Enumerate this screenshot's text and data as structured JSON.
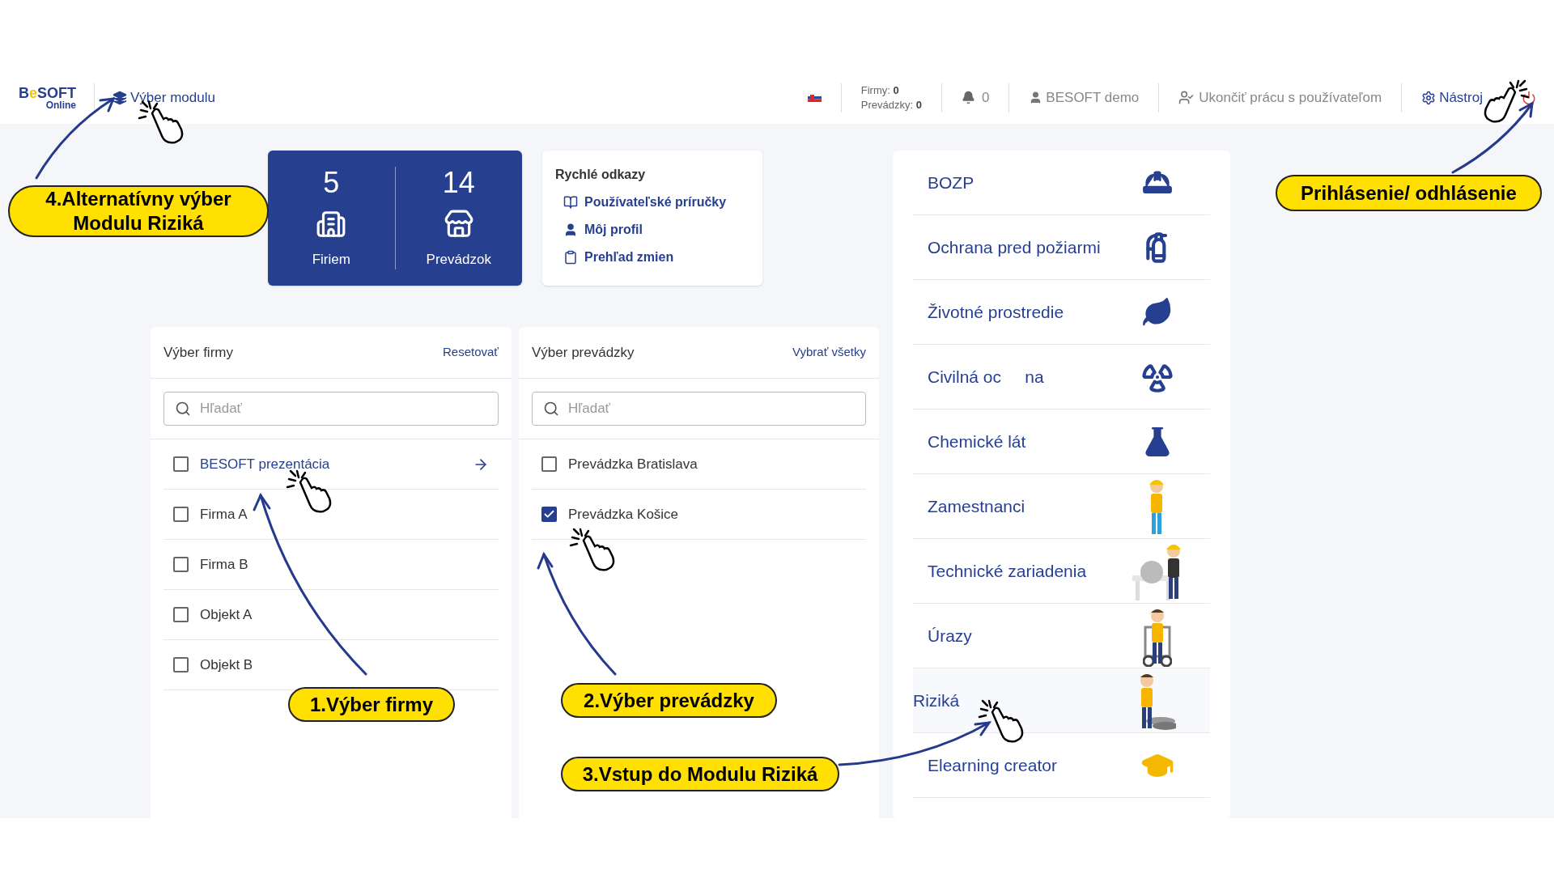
{
  "header": {
    "logo": {
      "parts": [
        "B",
        "e",
        "SOFT"
      ],
      "sub": "Online"
    },
    "module_link": "Výber modulu",
    "counts": [
      {
        "label": "Firmy:",
        "value": "0"
      },
      {
        "label": "Prevádzky:",
        "value": "0"
      }
    ],
    "notifications": "0",
    "user": "BESOFT demo",
    "end_session": "Ukončiť prácu s používateľom",
    "tools": "Nástroj"
  },
  "stats": [
    {
      "value": "5",
      "label": "Firiem",
      "kind": "building"
    },
    {
      "value": "14",
      "label": "Prevádzok",
      "kind": "store"
    }
  ],
  "quick_links": {
    "title": "Rychlé odkazy",
    "items": [
      {
        "label": "Používateľské príručky",
        "kind": "book"
      },
      {
        "label": "Môj profil",
        "kind": "user"
      },
      {
        "label": "Prehľad zmien",
        "kind": "clipboard"
      }
    ]
  },
  "firm_panel": {
    "title": "Výber firmy",
    "action": "Resetovať",
    "placeholder": "Hľadať",
    "rows": [
      {
        "label": "BESOFT prezentácia",
        "checked": false,
        "selected": true
      },
      {
        "label": "Firma A",
        "checked": false,
        "selected": false
      },
      {
        "label": "Firma B",
        "checked": false,
        "selected": false
      },
      {
        "label": "Objekt A",
        "checked": false,
        "selected": false
      },
      {
        "label": "Objekt B",
        "checked": false,
        "selected": false
      }
    ]
  },
  "shop_panel": {
    "title": "Výber prevádzky",
    "action": "Vybrať všetky",
    "placeholder": "Hľadať",
    "rows": [
      {
        "label": "Prevádzka Bratislava",
        "checked": false
      },
      {
        "label": "Prevádzka Košice",
        "checked": true
      }
    ]
  },
  "modules": [
    {
      "label": "BOZP",
      "kind": "helmet",
      "selected": false
    },
    {
      "label": "Ochrana pred požiarmi",
      "kind": "extinguisher",
      "selected": false
    },
    {
      "label": "Životné prostredie",
      "kind": "leaf",
      "selected": false
    },
    {
      "label": "Civilná oc     na",
      "kind": "radiation",
      "selected": false
    },
    {
      "label": "Chemické lát",
      "kind": "flask",
      "selected": false
    },
    {
      "label": "Zamestnanci",
      "kind": "worker",
      "selected": false
    },
    {
      "label": "Technické zariadenia",
      "kind": "machine",
      "selected": false
    },
    {
      "label": "Úrazy",
      "kind": "wheelchair",
      "selected": false
    },
    {
      "label": "Riziká",
      "kind": "walker",
      "selected": true
    },
    {
      "label": "Elearning creator",
      "kind": "cap",
      "selected": false
    }
  ],
  "callouts": [
    "4.Alternatívny výber Modulu Riziká",
    "Prihlásenie/ odhlásenie",
    "1.Výber firmy",
    "2.Výber prevádzky",
    "3.Vstup do Modulu Riziká"
  ]
}
